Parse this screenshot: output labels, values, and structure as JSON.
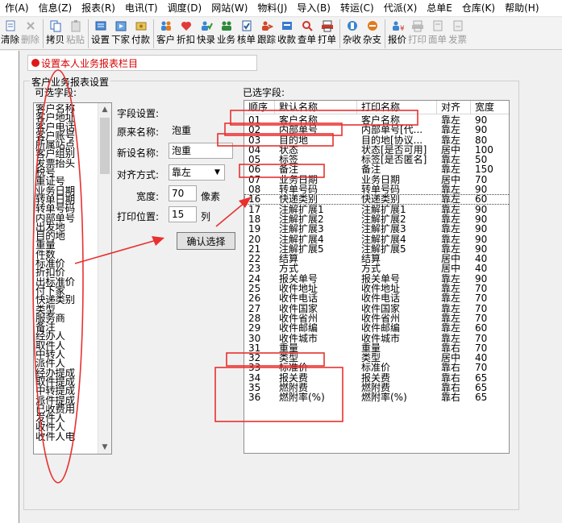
{
  "menu": [
    "作(A)",
    "信息(Z)",
    "报表(R)",
    "电讯(T)",
    "调度(D)",
    "网站(W)",
    "物料(J)",
    "导入(B)",
    "转运(C)",
    "代派(X)",
    "总单E",
    "仓库(K)",
    "帮助(H)"
  ],
  "toolbar": [
    {
      "label": "清除",
      "icon": "clear-icon",
      "enabled": true
    },
    {
      "label": "删除",
      "icon": "delete-icon",
      "enabled": false
    },
    {
      "label": "拷贝",
      "icon": "copy-icon",
      "enabled": true
    },
    {
      "label": "粘贴",
      "icon": "paste-icon",
      "enabled": false
    },
    {
      "label": "设置",
      "icon": "settings-icon",
      "enabled": true
    },
    {
      "label": "下家",
      "icon": "next-party-icon",
      "enabled": true
    },
    {
      "label": "付款",
      "icon": "payment-icon",
      "enabled": true
    },
    {
      "label": "客户",
      "icon": "customer-icon",
      "enabled": true
    },
    {
      "label": "折扣",
      "icon": "discount-icon",
      "enabled": true
    },
    {
      "label": "快录",
      "icon": "quick-entry-icon",
      "enabled": true
    },
    {
      "label": "业务",
      "icon": "business-icon",
      "enabled": true
    },
    {
      "label": "核单",
      "icon": "verify-icon",
      "enabled": true
    },
    {
      "label": "跟踪",
      "icon": "track-icon",
      "enabled": true
    },
    {
      "label": "收款",
      "icon": "receive-payment-icon",
      "enabled": true
    },
    {
      "label": "查单",
      "icon": "search-order-icon",
      "enabled": true
    },
    {
      "label": "打单",
      "icon": "print-order-icon",
      "enabled": true
    },
    {
      "label": "杂收",
      "icon": "misc-income-icon",
      "enabled": true
    },
    {
      "label": "杂支",
      "icon": "misc-expense-icon",
      "enabled": true
    },
    {
      "label": "报价",
      "icon": "quote-icon",
      "enabled": true
    },
    {
      "label": "打印",
      "icon": "print-icon",
      "enabled": false
    },
    {
      "label": "面单",
      "icon": "waybill-icon",
      "enabled": false
    },
    {
      "label": "发票",
      "icon": "invoice-icon",
      "enabled": false
    }
  ],
  "title": "设置本人业务报表栏目",
  "group_title": "客户业务报表设置",
  "available": {
    "label": "可选字段:",
    "items": [
      "客户名称",
      "客户地址",
      "客户电话",
      "客户账号",
      "所属站点",
      "客户组别",
      "发票抬头",
      "税号",
      "重证号",
      "业务日期",
      "转单日期",
      "转单号码",
      "内部单号",
      "出发地",
      "目的地",
      "重量",
      "件数",
      "标准价",
      "折扣价",
      "出标准价",
      "付下家",
      "快递类别",
      "类型",
      "服务商",
      "备注",
      "经办人",
      "取件人",
      "中转人",
      "派件人",
      "经办提成",
      "取件提成",
      "中转提成",
      "派件提成",
      "已收费用",
      "发件人",
      "收件人",
      "收件人电"
    ]
  },
  "settings": {
    "field_label": "字段设置:",
    "orig_label": "原来名称:",
    "orig_value": "泡重",
    "new_label": "新设名称:",
    "new_value": "泡重",
    "align_label": "对齐方式:",
    "align_value": "靠左",
    "width_label": "宽度:",
    "width_value": "70",
    "width_unit": "像素",
    "pos_label": "打印位置:",
    "pos_value": "15",
    "pos_unit": "列",
    "confirm_label": "确认选择"
  },
  "selected": {
    "label": "已选字段:",
    "columns": [
      "顺序",
      "默认名称",
      "打印名称",
      "对齐",
      "宽度",
      ""
    ],
    "rows": [
      [
        "01",
        "客户名称",
        "客户名称",
        "靠左",
        "90"
      ],
      [
        "02",
        "内部单号",
        "内部单号[代...",
        "靠左",
        "90"
      ],
      [
        "03",
        "目的地",
        "目的地[协议...",
        "靠左",
        "80"
      ],
      [
        "04",
        "状态",
        "状态[是否可用]",
        "居中",
        "100"
      ],
      [
        "05",
        "标签",
        "标签[是否匿名]",
        "靠左",
        "50"
      ],
      [
        "06",
        "备注",
        "备注",
        "靠左",
        "150"
      ],
      [
        "07",
        "业务日期",
        "业务日期",
        "居中",
        "70"
      ],
      [
        "08",
        "转单号码",
        "转单号码",
        "靠左",
        "90"
      ],
      [
        "16",
        "快递类别",
        "快递类别",
        "靠左",
        "60"
      ],
      [
        "17",
        "注解扩展1",
        "注解扩展1",
        "靠左",
        "90"
      ],
      [
        "18",
        "注解扩展2",
        "注解扩展2",
        "靠左",
        "90"
      ],
      [
        "19",
        "注解扩展3",
        "注解扩展3",
        "靠左",
        "90"
      ],
      [
        "20",
        "注解扩展4",
        "注解扩展4",
        "靠左",
        "90"
      ],
      [
        "21",
        "注解扩展5",
        "注解扩展5",
        "靠左",
        "90"
      ],
      [
        "22",
        "结算",
        "结算",
        "居中",
        "40"
      ],
      [
        "23",
        "方式",
        "方式",
        "居中",
        "40"
      ],
      [
        "24",
        "报关单号",
        "报关单号",
        "靠左",
        "90"
      ],
      [
        "25",
        "收件地址",
        "收件地址",
        "靠左",
        "70"
      ],
      [
        "26",
        "收件电话",
        "收件电话",
        "靠左",
        "70"
      ],
      [
        "27",
        "收件国家",
        "收件国家",
        "靠左",
        "70"
      ],
      [
        "28",
        "收件省州",
        "收件省州",
        "靠左",
        "70"
      ],
      [
        "29",
        "收件邮编",
        "收件邮编",
        "靠左",
        "60"
      ],
      [
        "30",
        "收件城市",
        "收件城市",
        "靠左",
        "70"
      ],
      [
        "31",
        "重量",
        "重量",
        "靠右",
        "70"
      ],
      [
        "32",
        "类型",
        "类型",
        "居中",
        "40"
      ],
      [
        "33",
        "标准价",
        "标准价",
        "靠右",
        "70"
      ],
      [
        "34",
        "报关费",
        "报关费",
        "靠右",
        "65"
      ],
      [
        "35",
        "燃附费",
        "燃附费",
        "靠右",
        "65"
      ],
      [
        "36",
        "燃附率(%)",
        "燃附率(%)",
        "靠右",
        "65"
      ]
    ],
    "focused_row": 8
  },
  "colors": {
    "title_red": "#d40000",
    "annotation_red": "#e8312f"
  }
}
